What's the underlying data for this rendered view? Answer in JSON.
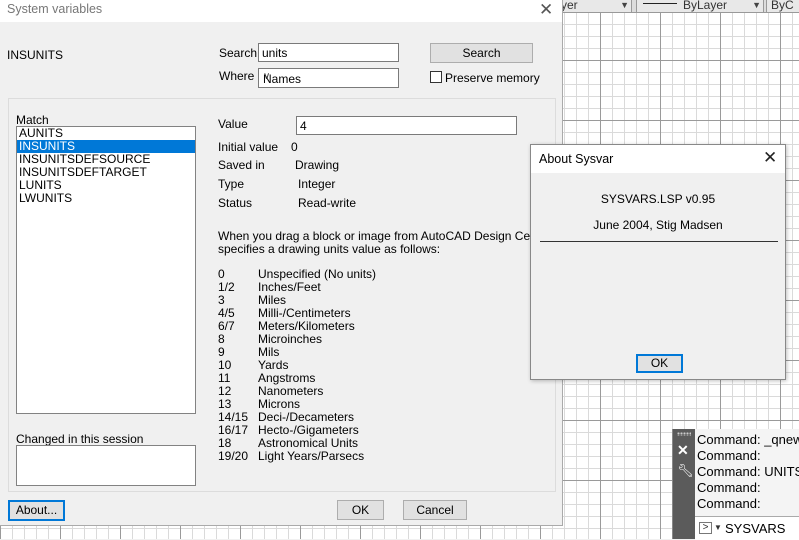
{
  "cad": {
    "combo_left": "yer",
    "combo_mid": "ByLayer",
    "combo_right": "ByC"
  },
  "command_window": {
    "history": [
      "Command: _qnew",
      "Command:",
      "Command: UNITS",
      "Command:",
      "Command:"
    ],
    "input_text": "SYSVARS"
  },
  "dialog": {
    "title": "System variables",
    "variable_name": "INSUNITS",
    "search_label": "Search",
    "search_value": "units",
    "search_button": "Search",
    "where_label": "Where",
    "where_value": "Names",
    "preserve_label": "Preserve memory",
    "preserve_checked": false,
    "match_label": "Match",
    "match_items": [
      "AUNITS",
      "INSUNITS",
      "INSUNITSDEFSOURCE",
      "INSUNITSDEFTARGET",
      "LUNITS",
      "LWUNITS"
    ],
    "selected_index": 1,
    "changed_label": "Changed in this session",
    "value_label": "Value",
    "value": "4",
    "initial_label": "Initial value",
    "initial_value": "0",
    "saved_label": "Saved in",
    "saved_value": "Drawing",
    "type_label": "Type",
    "type_value": "Integer",
    "status_label": "Status",
    "status_value": "Read-write",
    "description_line1": "When you drag a block or image from AutoCAD Design Center,",
    "description_line2": "specifies a drawing units value as follows:",
    "units": [
      {
        "code": "0",
        "name": "Unspecified (No units)"
      },
      {
        "code": "1/2",
        "name": "Inches/Feet"
      },
      {
        "code": "3",
        "name": "Miles"
      },
      {
        "code": "4/5",
        "name": "Milli-/Centimeters"
      },
      {
        "code": "6/7",
        "name": "Meters/Kilometers"
      },
      {
        "code": "8",
        "name": "Microinches"
      },
      {
        "code": "9",
        "name": "Mils"
      },
      {
        "code": "10",
        "name": "Yards"
      },
      {
        "code": "11",
        "name": "Angstroms"
      },
      {
        "code": "12",
        "name": "Nanometers"
      },
      {
        "code": "13",
        "name": "Microns"
      },
      {
        "code": "14/15",
        "name": "Deci-/Decameters"
      },
      {
        "code": "16/17",
        "name": "Hecto-/Gigameters"
      },
      {
        "code": "18",
        "name": "Astronomical Units"
      },
      {
        "code": "19/20",
        "name": "Light Years/Parsecs"
      }
    ],
    "about_button": "About...",
    "ok_button": "OK",
    "cancel_button": "Cancel"
  },
  "about": {
    "title": "About Sysvar",
    "line1": "SYSVARS.LSP  v0.95",
    "line2": "June 2004, Stig Madsen",
    "ok_button": "OK"
  },
  "icons": {
    "close": "close-icon",
    "dropdown": "chevron-down-icon",
    "wrench": "wrench-icon",
    "prompt": "command-prompt-icon"
  }
}
